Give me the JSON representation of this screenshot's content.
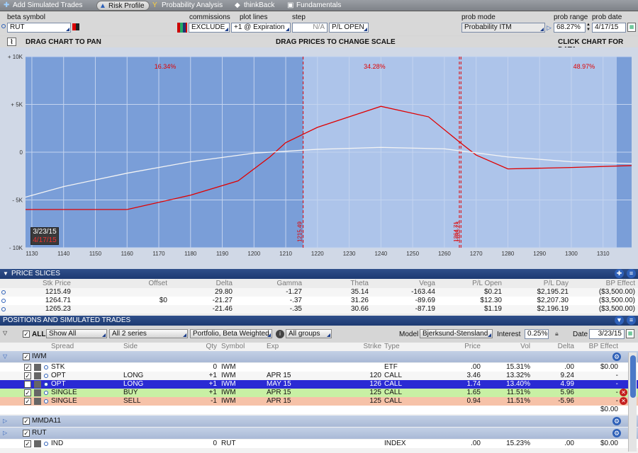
{
  "tabs": [
    {
      "label": "Add Simulated Trades",
      "icon": "plus-icon"
    },
    {
      "label": "Risk Profile",
      "icon": "risk-profile-icon"
    },
    {
      "label": "Probability Analysis",
      "icon": "probability-icon"
    },
    {
      "label": "thinkBack",
      "icon": "thinkback-icon"
    },
    {
      "label": "Fundamentals",
      "icon": "fundamentals-icon"
    }
  ],
  "controls": {
    "beta_symbol_label": "beta symbol",
    "beta_symbol_value": "RUT",
    "commissions_label": "commissions",
    "commissions_value": "EXCLUDE",
    "plot_lines_label": "plot lines",
    "plot_lines_value": "+1 @ Expiration",
    "step_label": "step",
    "step_value": "N/A",
    "pl_value": "P/L OPEN",
    "prob_mode_label": "prob mode",
    "prob_mode_value": "Probability ITM",
    "prob_range_label": "prob range",
    "prob_range_value": "68.27%",
    "prob_date_label": "prob date",
    "prob_date_value": "4/17/15"
  },
  "chart_header": {
    "pan": "DRAG CHART TO PAN",
    "scale": "DRAG PRICES TO CHANGE SCALE",
    "click": "CLICK CHART FOR DATA"
  },
  "chart_data": {
    "type": "line",
    "ylabels": [
      "+ 10K",
      "+ 5K",
      "0",
      "- 5K",
      "- 10K"
    ],
    "yticks": [
      10000,
      5000,
      0,
      -5000,
      -10000
    ],
    "ylim": [
      -10000,
      10000
    ],
    "xlim": [
      1128,
      1319
    ],
    "xticks": [
      1130,
      1140,
      1150,
      1160,
      1170,
      1180,
      1190,
      1200,
      1210,
      1220,
      1230,
      1240,
      1250,
      1260,
      1270,
      1280,
      1290,
      1300,
      1310
    ],
    "series": [
      {
        "color": "#e00000",
        "values": [
          [
            1128,
            -6000
          ],
          [
            1160,
            -6000
          ],
          [
            1180,
            -4500
          ],
          [
            1195,
            -3000
          ],
          [
            1205,
            -500
          ],
          [
            1210,
            1000
          ],
          [
            1215,
            1800
          ],
          [
            1220,
            2600
          ],
          [
            1240,
            4800
          ],
          [
            1255,
            3700
          ],
          [
            1265,
            1000
          ],
          [
            1270,
            -300
          ],
          [
            1280,
            -1750
          ],
          [
            1300,
            -1600
          ],
          [
            1319,
            -1400
          ]
        ]
      },
      {
        "color": "#f4f4f4",
        "values": [
          [
            1128,
            -4700
          ],
          [
            1140,
            -3600
          ],
          [
            1160,
            -2200
          ],
          [
            1180,
            -1000
          ],
          [
            1200,
            -100
          ],
          [
            1220,
            300
          ],
          [
            1240,
            500
          ],
          [
            1260,
            350
          ],
          [
            1280,
            -500
          ],
          [
            1300,
            -1000
          ],
          [
            1319,
            -1200
          ]
        ]
      }
    ],
    "probabilities": [
      {
        "label": "16.34%",
        "x": 1172
      },
      {
        "label": "34.28%",
        "x": 1238
      },
      {
        "label": "48.97%",
        "x": 1304
      }
    ],
    "breakevens": [
      {
        "label": "1215.49",
        "x": 1215.49
      },
      {
        "label": "1264.71",
        "x": 1264.71
      },
      {
        "label": "1265.23",
        "x": 1265.23
      }
    ],
    "date_box": {
      "date": "3/23/15",
      "prob_date": "4/17/15"
    }
  },
  "price_slices": {
    "title": "PRICE SLICES",
    "headers": [
      "Stk Price",
      "Offset",
      "Delta",
      "Gamma",
      "Theta",
      "Vega",
      "P/L Open",
      "P/L Day",
      "BP Effect"
    ],
    "rows": [
      [
        "1215.49",
        "",
        "29.80",
        "-1.27",
        "35.14",
        "-163.44",
        "$0.21",
        "$2,195.21",
        "($3,500.00)"
      ],
      [
        "1264.71",
        "$0",
        "-21.27",
        "-.37",
        "31.26",
        "-89.69",
        "$12.30",
        "$2,207.30",
        "($3,500.00)"
      ],
      [
        "1265.23",
        "",
        "-21.46",
        "-.35",
        "30.66",
        "-87.19",
        "$1.19",
        "$2,196.19",
        "($3,500.00)"
      ]
    ]
  },
  "positions": {
    "title": "POSITIONS AND SIMULATED TRADES",
    "all_label": "ALL",
    "show_filter": "Show All",
    "series_filter": "All 2 series",
    "weight_filter": "Portfolio, Beta Weighted",
    "groups_filter": "All groups",
    "model_label": "Model",
    "model_value": "Bjerksund-Stensland",
    "interest_label": "Interest",
    "interest_value": "0.25%",
    "date_label": "Date",
    "date_value": "3/23/15",
    "headers": [
      "Spread",
      "Side",
      "Qty",
      "Symbol",
      "Exp",
      "Strike",
      "Type",
      "Price",
      "Vol",
      "Delta",
      "BP Effect"
    ],
    "groups": [
      {
        "name": "IWM",
        "rows": [
          {
            "spread": "STK",
            "side": "",
            "qty": "0",
            "symbol": "IWM",
            "exp": "",
            "strike": "",
            "type": "ETF",
            "price": ".00",
            "vol": "15.31%",
            "delta": ".00",
            "bp": "$0.00"
          },
          {
            "spread": "OPT",
            "side": "LONG",
            "qty": "+1",
            "symbol": "IWM",
            "exp": "APR 15",
            "strike": "120",
            "type": "CALL",
            "price": "3.46",
            "vol": "13.32%",
            "delta": "9.24",
            "bp": "-"
          },
          {
            "spread": "OPT",
            "side": "LONG",
            "qty": "+1",
            "symbol": "IWM",
            "exp": "MAY 15",
            "strike": "126",
            "type": "CALL",
            "price": "1.74",
            "vol": "13.40%",
            "delta": "4.99",
            "bp": "-"
          },
          {
            "spread": "SINGLE",
            "side": "BUY",
            "qty": "+1",
            "symbol": "IWM",
            "exp": "APR 15",
            "strike": "125",
            "type": "CALL",
            "price": "1.65",
            "vol": "11.51%",
            "delta": "5.96",
            "bp": "-"
          },
          {
            "spread": "SINGLE",
            "side": "SELL",
            "qty": "-1",
            "symbol": "IWM",
            "exp": "APR 15",
            "strike": "125",
            "type": "CALL",
            "price": "0.94",
            "vol": "11.51%",
            "delta": "-5.96",
            "bp": "-"
          }
        ],
        "total": "$0.00"
      },
      {
        "name": "MMDA11",
        "rows": []
      },
      {
        "name": "RUT",
        "rows": [
          {
            "spread": "IND",
            "side": "",
            "qty": "0",
            "symbol": "RUT",
            "exp": "",
            "strike": "",
            "type": "INDEX",
            "price": ".00",
            "vol": "15.23%",
            "delta": ".00",
            "bp": "$0.00"
          }
        ]
      }
    ]
  }
}
